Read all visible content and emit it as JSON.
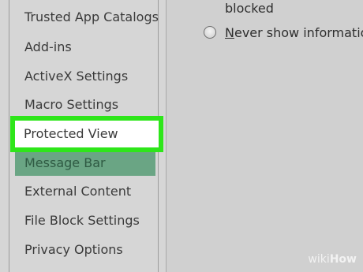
{
  "sidebar": {
    "items": [
      {
        "label": "Trusted App Catalogs"
      },
      {
        "label": "Add-ins"
      },
      {
        "label": "ActiveX Settings"
      },
      {
        "label": "Macro Settings"
      },
      {
        "label": "Protected View",
        "state": "highlighted"
      },
      {
        "label": "Message Bar",
        "state": "selected"
      },
      {
        "label": "External Content"
      },
      {
        "label": "File Block Settings"
      },
      {
        "label": "Privacy Options"
      }
    ]
  },
  "main": {
    "blocked_text": "blocked",
    "never_show_option": {
      "accel": "N",
      "rest": "ever show information",
      "checked": false
    }
  },
  "watermark": {
    "wiki": "wiki",
    "how": "How"
  },
  "colors": {
    "highlight_border": "#2ee61a",
    "selected_bg": "#6aa584",
    "background": "#d3d3d3"
  }
}
